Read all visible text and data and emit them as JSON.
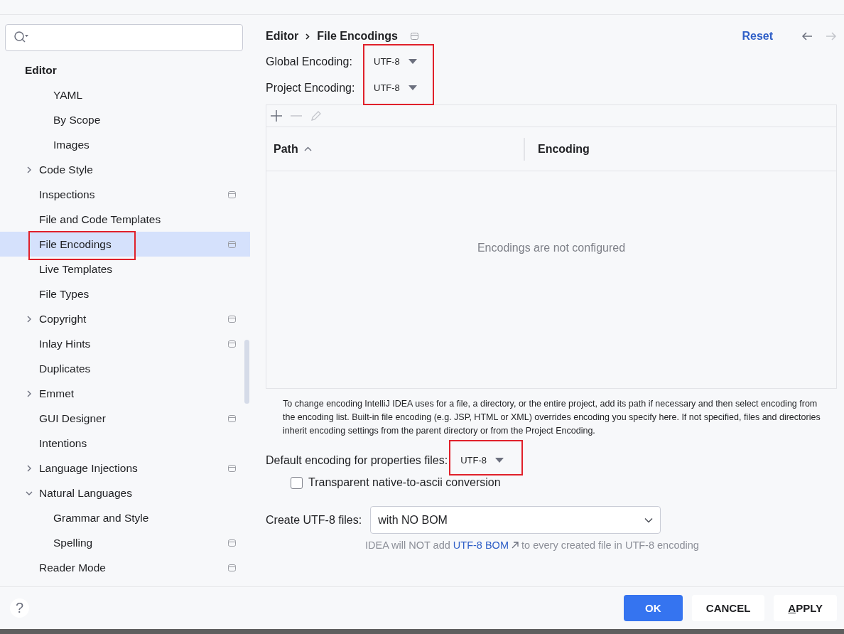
{
  "sidebar": {
    "items": [
      {
        "label": "Editor",
        "children": [
          {
            "children": [
              {
                "label": "YAML",
                "selected": false
              },
              {
                "label": "By Scope",
                "selected": false
              },
              {
                "label": "Images",
                "selected": false
              }
            ]
          },
          {
            "label": "Code Style",
            "expanded": false,
            "selected": false
          },
          {
            "label": "Inspections",
            "selected": false,
            "project": true
          },
          {
            "label": "File and Code Templates",
            "selected": false
          },
          {
            "label": "File Encodings",
            "selected": true,
            "project": true,
            "highlighted": true
          },
          {
            "label": "Live Templates",
            "selected": false
          },
          {
            "label": "File Types",
            "selected": false
          },
          {
            "label": "Copyright",
            "expanded": false,
            "selected": false,
            "project": true
          },
          {
            "label": "Inlay Hints",
            "selected": false,
            "project": true
          },
          {
            "label": "Duplicates",
            "selected": false
          },
          {
            "label": "Emmet",
            "expanded": false,
            "selected": false
          },
          {
            "label": "GUI Designer",
            "selected": false,
            "project": true
          },
          {
            "label": "Intentions",
            "selected": false
          },
          {
            "label": "Language Injections",
            "expanded": false,
            "selected": false,
            "project": true
          },
          {
            "label": "Natural Languages",
            "expanded": true,
            "selected": false,
            "children": [
              {
                "label": "Grammar and Style",
                "selected": false
              },
              {
                "label": "Spelling",
                "selected": false,
                "project": true
              }
            ]
          },
          {
            "label": "Reader Mode",
            "selected": false,
            "project": true
          }
        ]
      }
    ]
  },
  "breadcrumb": [
    "Editor",
    "File Encodings"
  ],
  "reset": "Reset",
  "encodings": {
    "highlighted": true,
    "rows": [
      {
        "label": "Global Encoding:",
        "value": "UTF-8"
      },
      {
        "label": "Project Encoding:",
        "value": "UTF-8"
      }
    ]
  },
  "table": {
    "columns": [
      {
        "label": "Path",
        "sorted": true
      },
      {
        "label": "Encoding",
        "sorted": false
      }
    ],
    "empty_text": "Encodings are not configured"
  },
  "help_text": "To change encoding IntelliJ IDEA uses for a file, a directory, or the entire project, add its path if necessary and then select encoding from the encoding list. Built-in file encoding (e.g. JSP, HTML or XML) overrides encoding you specify here. If not specified, files and directories inherit encoding settings from the parent directory or from the Project Encoding.",
  "properties": {
    "label": "Default encoding for properties files:",
    "value": "UTF-8",
    "highlighted": true
  },
  "native_to_ascii": {
    "label": "Transparent native-to-ascii conversion",
    "checked": false
  },
  "bom": {
    "label": "Create UTF-8 files:",
    "value": "with NO BOM",
    "hint_before": "IDEA will NOT add",
    "hint_link": "UTF-8 BOM",
    "hint_after": "to every created file in UTF-8 encoding"
  },
  "help": "?",
  "buttons": [
    {
      "label": "OK",
      "kind": "primary",
      "mnemonic": false
    },
    {
      "label": "CANCEL",
      "kind": "plain",
      "mnemonic": false
    },
    {
      "label": "APPLY",
      "kind": "plain",
      "mnemonic": true
    }
  ]
}
